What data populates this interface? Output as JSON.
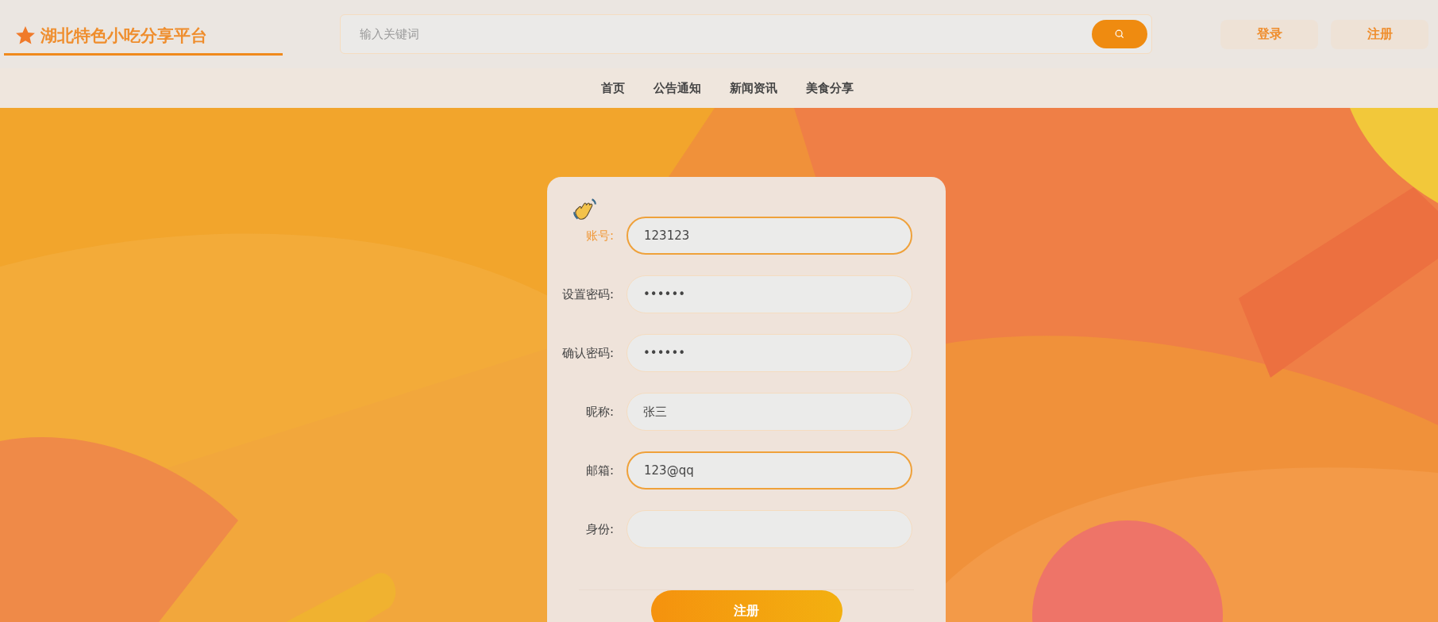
{
  "header": {
    "logo": "湖北特色小吃分享平台",
    "search": {
      "placeholder": "输入关键词"
    },
    "buttons": [
      "登录",
      "注册"
    ]
  },
  "nav": [
    "首页",
    "公告通知",
    "新闻资讯",
    "美食分享"
  ],
  "form": {
    "fields": [
      {
        "label": "账号:",
        "value": "123123",
        "active": true,
        "outlined": true
      },
      {
        "label": "设置密码:",
        "value": "••••••",
        "active": false,
        "outlined": false
      },
      {
        "label": "确认密码:",
        "value": "••••••",
        "active": false,
        "outlined": false
      },
      {
        "label": "昵称:",
        "value": "张三",
        "active": false,
        "outlined": false
      },
      {
        "label": "邮箱:",
        "value": "123@qq",
        "active": false,
        "outlined": true
      },
      {
        "label": "身份:",
        "active": false,
        "outlined": false
      }
    ],
    "submit": "注册"
  }
}
